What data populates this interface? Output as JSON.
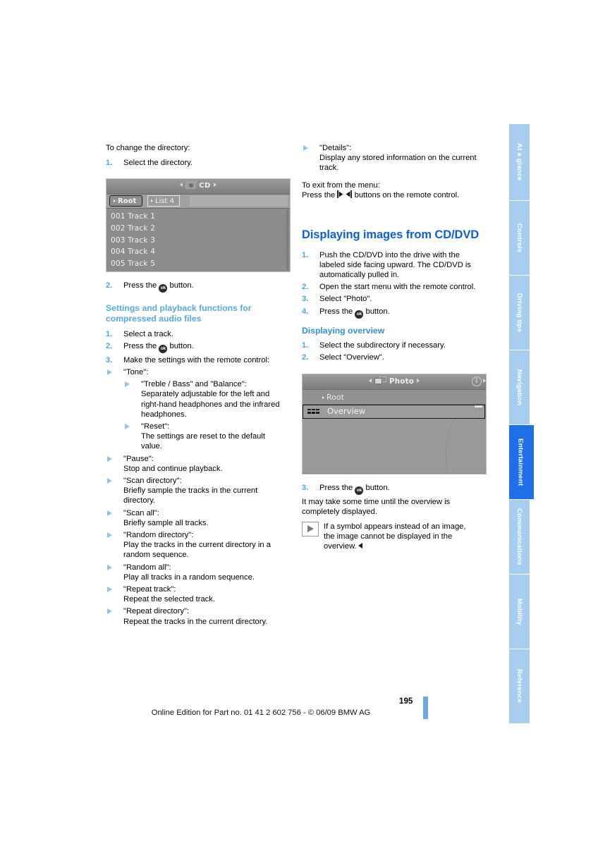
{
  "document": {
    "page_number": "195",
    "footer_text": "Online Edition for Part no. 01 41 2 602 756 - © 06/09 BMW AG"
  },
  "sidebar": {
    "tabs": [
      {
        "label": "At a glance",
        "active": false
      },
      {
        "label": "Controls",
        "active": false
      },
      {
        "label": "Driving tips",
        "active": false
      },
      {
        "label": "Navigation",
        "active": false
      },
      {
        "label": "Entertainment",
        "active": true
      },
      {
        "label": "Communications",
        "active": false
      },
      {
        "label": "Mobility",
        "active": false
      },
      {
        "label": "Reference",
        "active": false
      }
    ],
    "active_color": "#1f6fe8",
    "inactive_color": "#a8ceef"
  },
  "left_column": {
    "intro": "To change the directory:",
    "step1": {
      "num": "1.",
      "text": "Select the directory."
    },
    "screenshot_cd": {
      "title": "CD",
      "tab_root": "Root",
      "tab_list": "List 4",
      "rows": [
        "001 Track 1",
        "002 Track 2",
        "003 Track 3",
        "004 Track 4",
        "005 Track 5"
      ],
      "caption_code": ""
    },
    "step2": {
      "num": "2.",
      "pre": "Press the",
      "glyph": "ok",
      "post": "button."
    },
    "heading": "Settings and playback functions for compressed audio files",
    "steps": [
      {
        "num": "1.",
        "text": "Select a track."
      },
      {
        "num": "2.",
        "pre": "Press the",
        "glyph": "ok",
        "post": "button."
      },
      {
        "num": "3.",
        "text": "Make the settings with the remote control:"
      }
    ],
    "bullets": [
      {
        "title": "\"Tone\":",
        "body": "",
        "sub": [
          {
            "title": "\"Treble / Bass\" and \"Balance\":",
            "body": "Separately adjustable for the left and right-hand headphones and the infrared headphones."
          },
          {
            "title": "\"Reset\":",
            "body": "The settings are reset to the default value."
          }
        ]
      },
      {
        "title": "\"Pause\":",
        "body": "Stop and continue playback.",
        "sub": []
      },
      {
        "title": "\"Scan directory\":",
        "body": "Briefly sample the tracks in the current directory.",
        "sub": []
      },
      {
        "title": "\"Scan all\":",
        "body": "Briefly sample all tracks.",
        "sub": []
      },
      {
        "title": "\"Random directory\":",
        "body": "Play the tracks in the current directory in a random sequence.",
        "sub": []
      },
      {
        "title": "\"Random all\":",
        "body": "Play all tracks in a random sequence.",
        "sub": []
      },
      {
        "title": "\"Repeat track\":",
        "body": "Repeat the selected track.",
        "sub": []
      },
      {
        "title": "\"Repeat directory\":",
        "body": "Repeat the tracks in the current directory.",
        "sub": []
      }
    ]
  },
  "right_column": {
    "details_bullet": {
      "title": "\"Details\":",
      "body": "Display any stored information on the current track."
    },
    "exit_intro": "To exit from the menu:",
    "exit_pre": "Press the",
    "exit_post": "buttons on the remote control.",
    "heading_main": "Displaying images from CD/DVD",
    "steps": [
      {
        "num": "1.",
        "text": "Push the CD/DVD into the drive with the labeled side facing upward.",
        "extra": "The CD/DVD is automatically pulled in."
      },
      {
        "num": "2.",
        "text": "Open the start menu with the remote control."
      },
      {
        "num": "3.",
        "text": "Select \"Photo\"."
      },
      {
        "num": "4.",
        "pre": "Press the",
        "glyph": "ok",
        "post": "button."
      }
    ],
    "heading_sub": "Displaying overview",
    "overview_steps": [
      {
        "num": "1.",
        "text": "Select the subdirectory if necessary."
      },
      {
        "num": "2.",
        "text": "Select \"Overview\"."
      }
    ],
    "screenshot_photo": {
      "title": "Photo",
      "root_label": "Root",
      "overview_label": "Overview",
      "caption_code": ""
    },
    "step3": {
      "num": "3.",
      "pre": "Press the",
      "glyph": "ok",
      "post": "button."
    },
    "after_text": "It may take some time until the overview is completely displayed.",
    "note": "If a symbol appears instead of an image, the image cannot be displayed in the overview."
  },
  "colors": {
    "heading_blue": "#0a5fe0",
    "subheading_blue": "#55a8e2",
    "number_blue": "#4ba3e3",
    "bullet_blue": "#8fc4ea"
  }
}
